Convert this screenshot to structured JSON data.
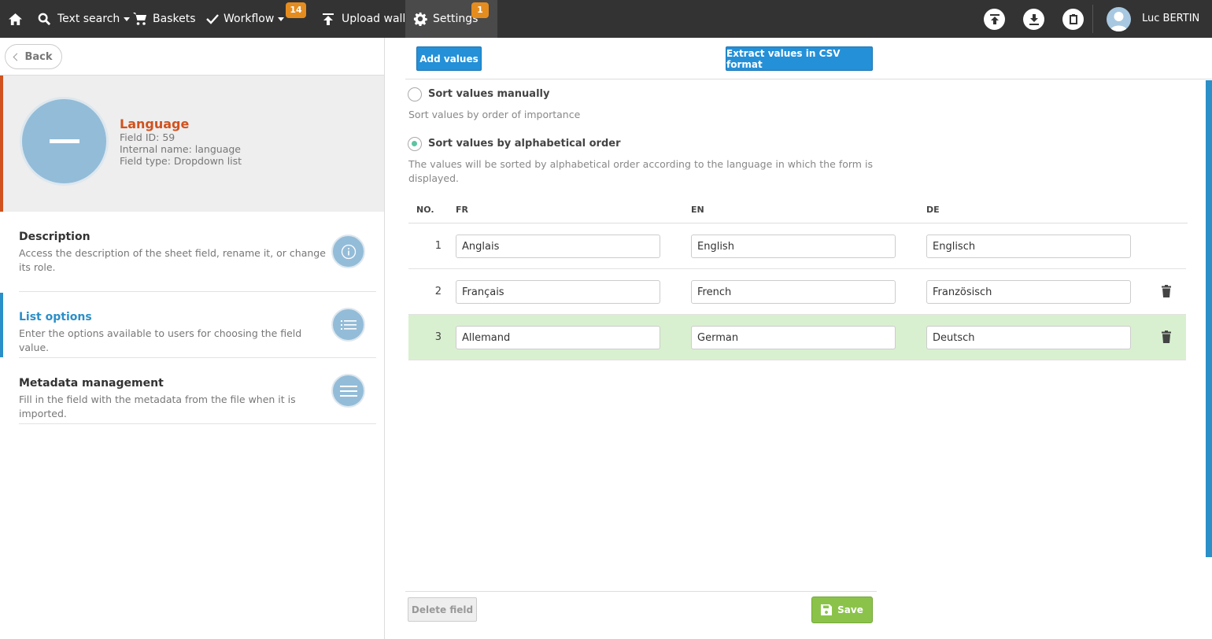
{
  "nav": {
    "search_label": "Text search",
    "baskets_label": "Baskets",
    "workflow_label": "Workflow",
    "workflow_badge": "14",
    "upload_label": "Upload wall",
    "settings_label": "Settings",
    "settings_badge": "1",
    "user_name": "Luc BERTIN"
  },
  "sidebar": {
    "back_label": "Back",
    "field": {
      "name": "Language",
      "id_text": "Field ID: 59",
      "internal_text": "Internal name: language",
      "type_text": "Field type: Dropdown list"
    },
    "sections": [
      {
        "title": "Description",
        "text": "Access the description of the sheet field, rename it, or change its role."
      },
      {
        "title": "List options",
        "text": "Enter the options available to users for choosing the field value."
      },
      {
        "title": "Metadata management",
        "text": "Fill in the field with the metadata from the file when it is imported."
      }
    ]
  },
  "main": {
    "add_values_label": "Add values",
    "extract_csv_label": "Extract values in CSV format",
    "sort_manual_label": "Sort values manually",
    "sort_manual_help": "Sort values by order of importance",
    "sort_alpha_label": "Sort values by alphabetical order",
    "sort_alpha_help": "The values will be sorted by alphabetical order according to the language in which the form is displayed.",
    "columns": [
      "NO.",
      "FR",
      "EN",
      "DE"
    ],
    "rows": [
      {
        "no": "1",
        "fr": "Anglais",
        "en": "English",
        "de": "Englisch"
      },
      {
        "no": "2",
        "fr": "Français",
        "en": "French",
        "de": "Französisch"
      },
      {
        "no": "3",
        "fr": "Allemand",
        "en": "German",
        "de": "Deutsch"
      }
    ],
    "delete_label": "Delete field",
    "save_label": "Save"
  },
  "colors": {
    "topbar": "#333333",
    "accent_blue": "#2490d8",
    "field_accent": "#d0521e",
    "badge": "#e58c1f",
    "save_green": "#8bc34a",
    "row_highlight": "#d9f0d0"
  }
}
